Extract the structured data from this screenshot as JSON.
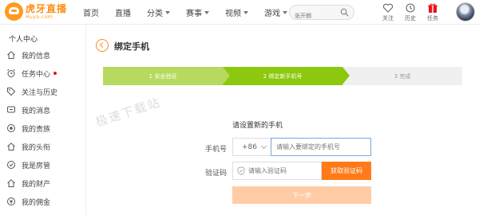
{
  "header": {
    "logo_cn": "虎牙直播",
    "logo_en": "Huya.com",
    "nav": [
      {
        "label": "首页",
        "dropdown": false
      },
      {
        "label": "直播",
        "dropdown": false
      },
      {
        "label": "分类",
        "dropdown": true
      },
      {
        "label": "赛事",
        "dropdown": true
      },
      {
        "label": "视频",
        "dropdown": true
      },
      {
        "label": "游戏",
        "dropdown": true
      }
    ],
    "search_placeholder": "张开朗",
    "icons": [
      {
        "label": "关注",
        "icon": "heart-icon"
      },
      {
        "label": "历史",
        "icon": "clock-icon"
      },
      {
        "label": "任务",
        "icon": "gift-icon"
      }
    ]
  },
  "sidebar": {
    "title": "个人中心",
    "items": [
      {
        "label": "我的信息",
        "icon": "home-icon",
        "badge": false
      },
      {
        "label": "任务中心",
        "icon": "alarm-icon",
        "badge": true
      },
      {
        "label": "关注与历史",
        "icon": "tag-icon",
        "badge": false
      },
      {
        "label": "我的消息",
        "icon": "message-icon",
        "badge": false
      },
      {
        "label": "我的贵族",
        "icon": "noble-icon",
        "badge": false
      },
      {
        "label": "我的头衔",
        "icon": "home-icon",
        "badge": false
      },
      {
        "label": "我是房管",
        "icon": "shield-icon",
        "badge": false
      },
      {
        "label": "我的财产",
        "icon": "home-icon",
        "badge": false
      },
      {
        "label": "我的佣金",
        "icon": "coin-icon",
        "badge": false
      }
    ]
  },
  "main": {
    "title": "绑定手机",
    "steps": [
      "1 安全验证",
      "2 绑定新手机号",
      "3 完成"
    ],
    "current_step": 2,
    "watermark": "极速下载站",
    "prompt": "请设置新的手机",
    "phone_label": "手机号",
    "country_code": "+86",
    "phone_placeholder": "请输入要绑定的手机号",
    "code_label": "验证码",
    "code_placeholder": "请输入验证码",
    "get_code_label": "获取验证码",
    "next_label": "下一步"
  },
  "colors": {
    "accent": "#ff7a18",
    "step_done": "#b7da5e",
    "step_active": "#8cc80e",
    "step_pending": "#f0f0f0",
    "next_disabled": "#ffcca6"
  }
}
